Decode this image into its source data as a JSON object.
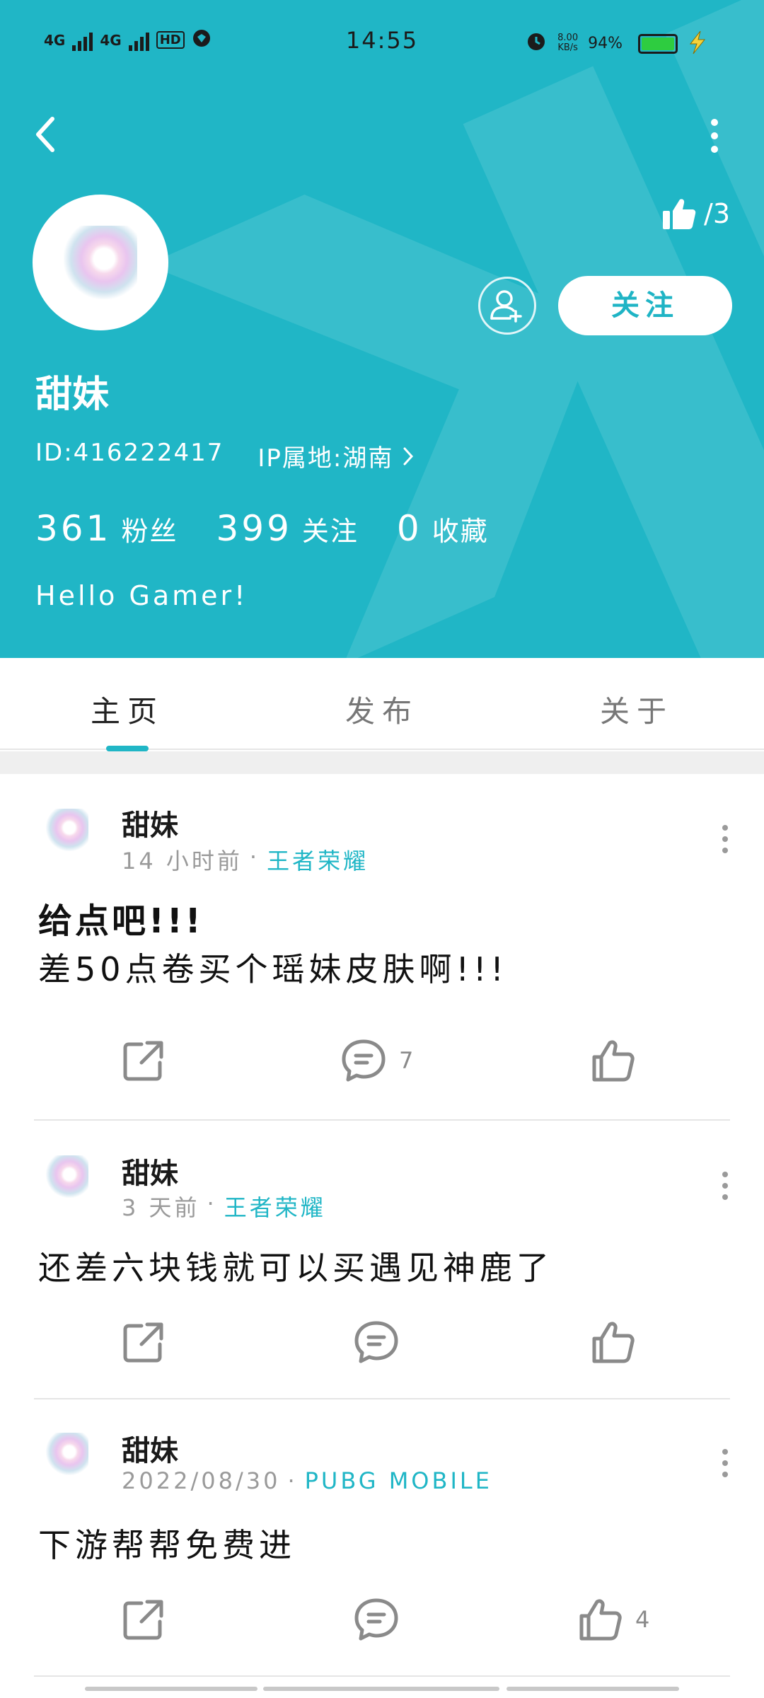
{
  "status_bar": {
    "left_label1": "4G",
    "left_label2": "4G",
    "hd_label": "HD",
    "time": "14:55",
    "net_speed_value": "8.00",
    "net_speed_unit": "KB/s",
    "battery": "94%",
    "battery_color": "#2ecc40",
    "icons": [
      "signal-icon",
      "signal-icon",
      "hd-icon",
      "vpn-icon",
      "alarm-icon",
      "battery-icon",
      "bolt-icon"
    ]
  },
  "profile": {
    "like_count": "/3",
    "follow_label": "关注",
    "name": "甜妹",
    "id_text": "ID:41622241​7",
    "ip_text": "IP属地:湖南",
    "stats": [
      {
        "num": "361",
        "label": "粉丝"
      },
      {
        "num": "399",
        "label": "关注"
      },
      {
        "num": "0",
        "label": "收藏"
      }
    ],
    "bio": "Hello Gamer!",
    "accent_color": "#20b6c6"
  },
  "tabs": [
    {
      "label": "主页",
      "active": true
    },
    {
      "label": "发布",
      "active": false
    },
    {
      "label": "关于",
      "active": false
    }
  ],
  "posts": [
    {
      "author": "甜妹",
      "time": "14 小时前",
      "sep": "·",
      "game": "王者荣耀",
      "title": "给点吧!!!",
      "body": "差50点卷买个瑶妹皮肤啊!!!",
      "comments": "7",
      "likes": ""
    },
    {
      "author": "甜妹",
      "time": "3 天前",
      "sep": "·",
      "game": "王者荣耀",
      "title": "",
      "body": "还差六块钱就可以买遇见神鹿了",
      "comments": "",
      "likes": ""
    },
    {
      "author": "甜妹",
      "time": "2022/08/30",
      "sep": "·",
      "game": "PUBG MOBILE",
      "title": "",
      "body": "下游帮帮免费进",
      "comments": "",
      "likes": "4"
    }
  ]
}
